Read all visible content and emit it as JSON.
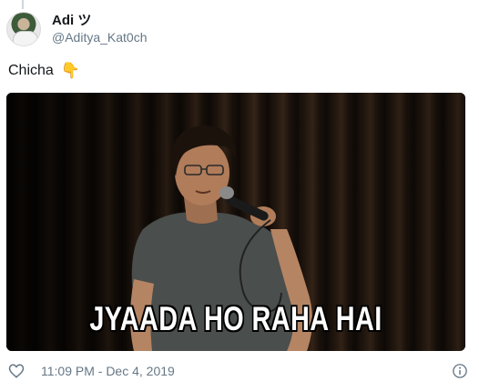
{
  "tweet": {
    "display_name": "Adi ツ",
    "handle": "@Aditya_Kat0ch",
    "text": "Chicha",
    "emoji": "👇",
    "timestamp": "11:09 PM - Dec 4, 2019"
  },
  "media": {
    "caption": "JYAADA HO RAHA HAI"
  },
  "icons": {
    "like": "heart-icon",
    "info": "info-icon",
    "emoji": "pointing-down-icon"
  },
  "colors": {
    "text_primary": "#14171a",
    "text_secondary": "#657786"
  }
}
